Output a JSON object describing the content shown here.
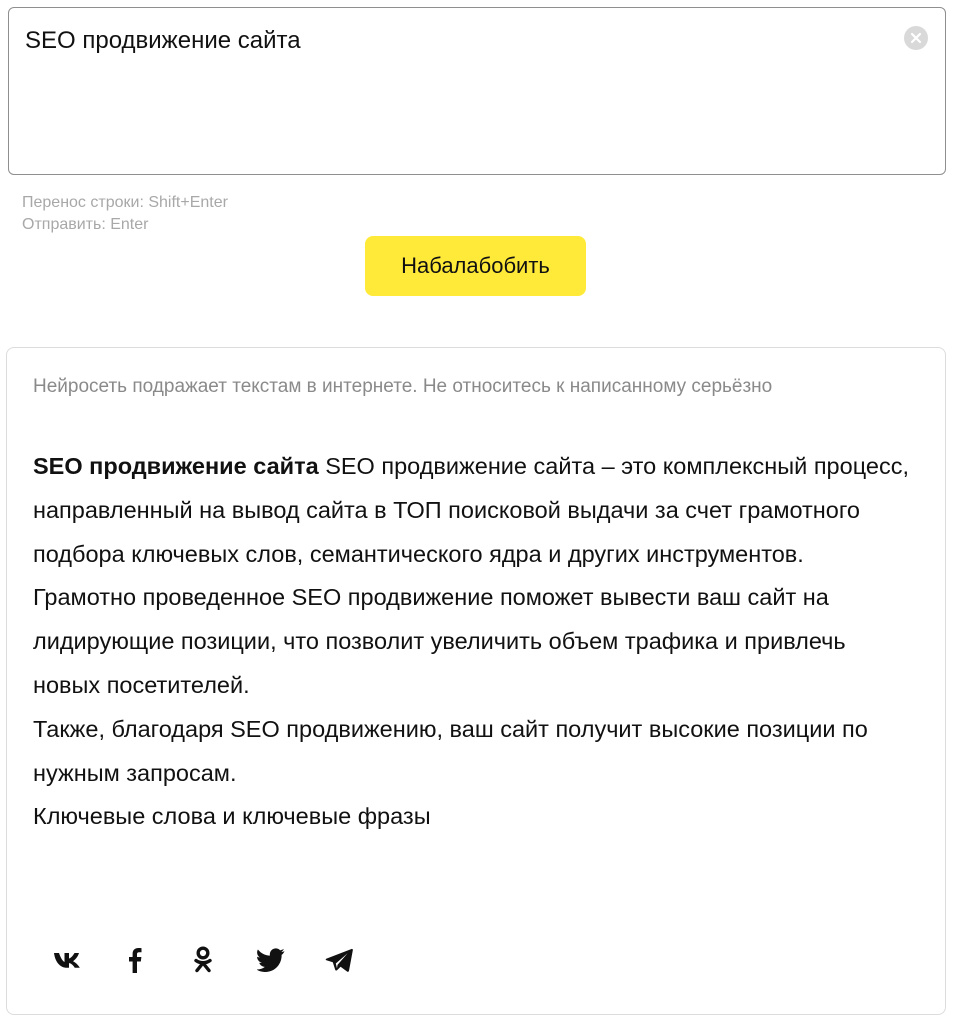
{
  "query": {
    "value": "SEO продвижение сайта",
    "clear_icon": "close-circle-icon"
  },
  "hints": {
    "line_break": "Перенос строки: Shift+Enter",
    "send": "Отправить: Enter"
  },
  "submit": {
    "label": "Набалабобить",
    "color": "#ffea39"
  },
  "result": {
    "disclaimer": "Нейросеть подражает текстам в интернете. Не относитесь к написанному серьёзно",
    "query_echo": "SEO продвижение сайта",
    "paragraphs": [
      " SEO продвижение сайта – это комплексный процесс, направленный на вывод сайта в ТОП поисковой выдачи за счет грамотного подбора ключевых слов, семантического ядра и других инструментов.",
      "Грамотно проведенное SEO продвижение поможет вывести ваш сайт на лидирующие позиции, что позволит увеличить объем трафика и привлечь новых посетителей.",
      "Также, благодаря SEO продвижению, ваш сайт получит высокие позиции по нужным запросам.",
      "Ключевые слова и ключевые фразы"
    ]
  },
  "share": [
    {
      "name": "vk-icon"
    },
    {
      "name": "facebook-icon"
    },
    {
      "name": "odnoklassniki-icon"
    },
    {
      "name": "twitter-icon"
    },
    {
      "name": "telegram-icon"
    }
  ]
}
